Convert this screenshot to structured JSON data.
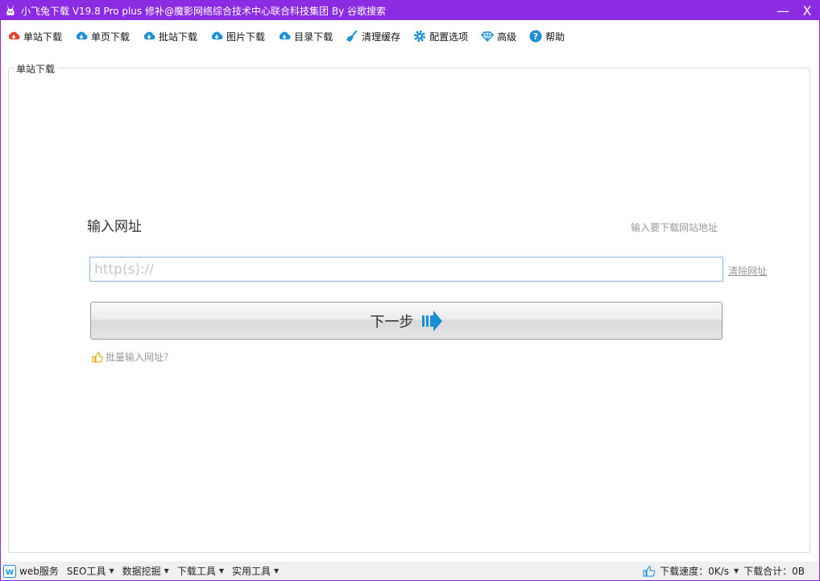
{
  "window": {
    "title": "小飞兔下载 V19.8 Pro plus 修补@魔影网络综合技术中心联合科技集团 By 谷歌搜索",
    "minimize_label": "—",
    "close_label": "X"
  },
  "toolbar": {
    "items": [
      {
        "label": "单站下载",
        "icon": "download-red-icon"
      },
      {
        "label": "单页下载",
        "icon": "download-blue-icon"
      },
      {
        "label": "批站下载",
        "icon": "download-blue-icon"
      },
      {
        "label": "图片下载",
        "icon": "download-blue-icon"
      },
      {
        "label": "目录下载",
        "icon": "download-blue-icon"
      },
      {
        "label": "清理缓存",
        "icon": "broom-icon"
      },
      {
        "label": "配置选项",
        "icon": "gear-icon"
      },
      {
        "label": "高级",
        "icon": "diamond-icon"
      },
      {
        "label": "帮助",
        "icon": "help-icon"
      }
    ]
  },
  "panel": {
    "legend": "单站下载",
    "heading": "输入网址",
    "hint": "输入要下载网站地址",
    "url_value": "",
    "url_placeholder": "http(s)://",
    "clear_label": "清除网址",
    "next_label": "下一步",
    "batch_label": "批量输入网址？"
  },
  "statusbar": {
    "web_label": "web服务",
    "menus": [
      "SEO工具",
      "数据挖掘",
      "下载工具",
      "实用工具"
    ],
    "speed_label": "下载速度：0K/s",
    "total_label": "下载合计：0B"
  },
  "colors": {
    "titlebar": "#8b2be2",
    "accent_blue": "#1a8fd6",
    "accent_red": "#e8402a"
  }
}
